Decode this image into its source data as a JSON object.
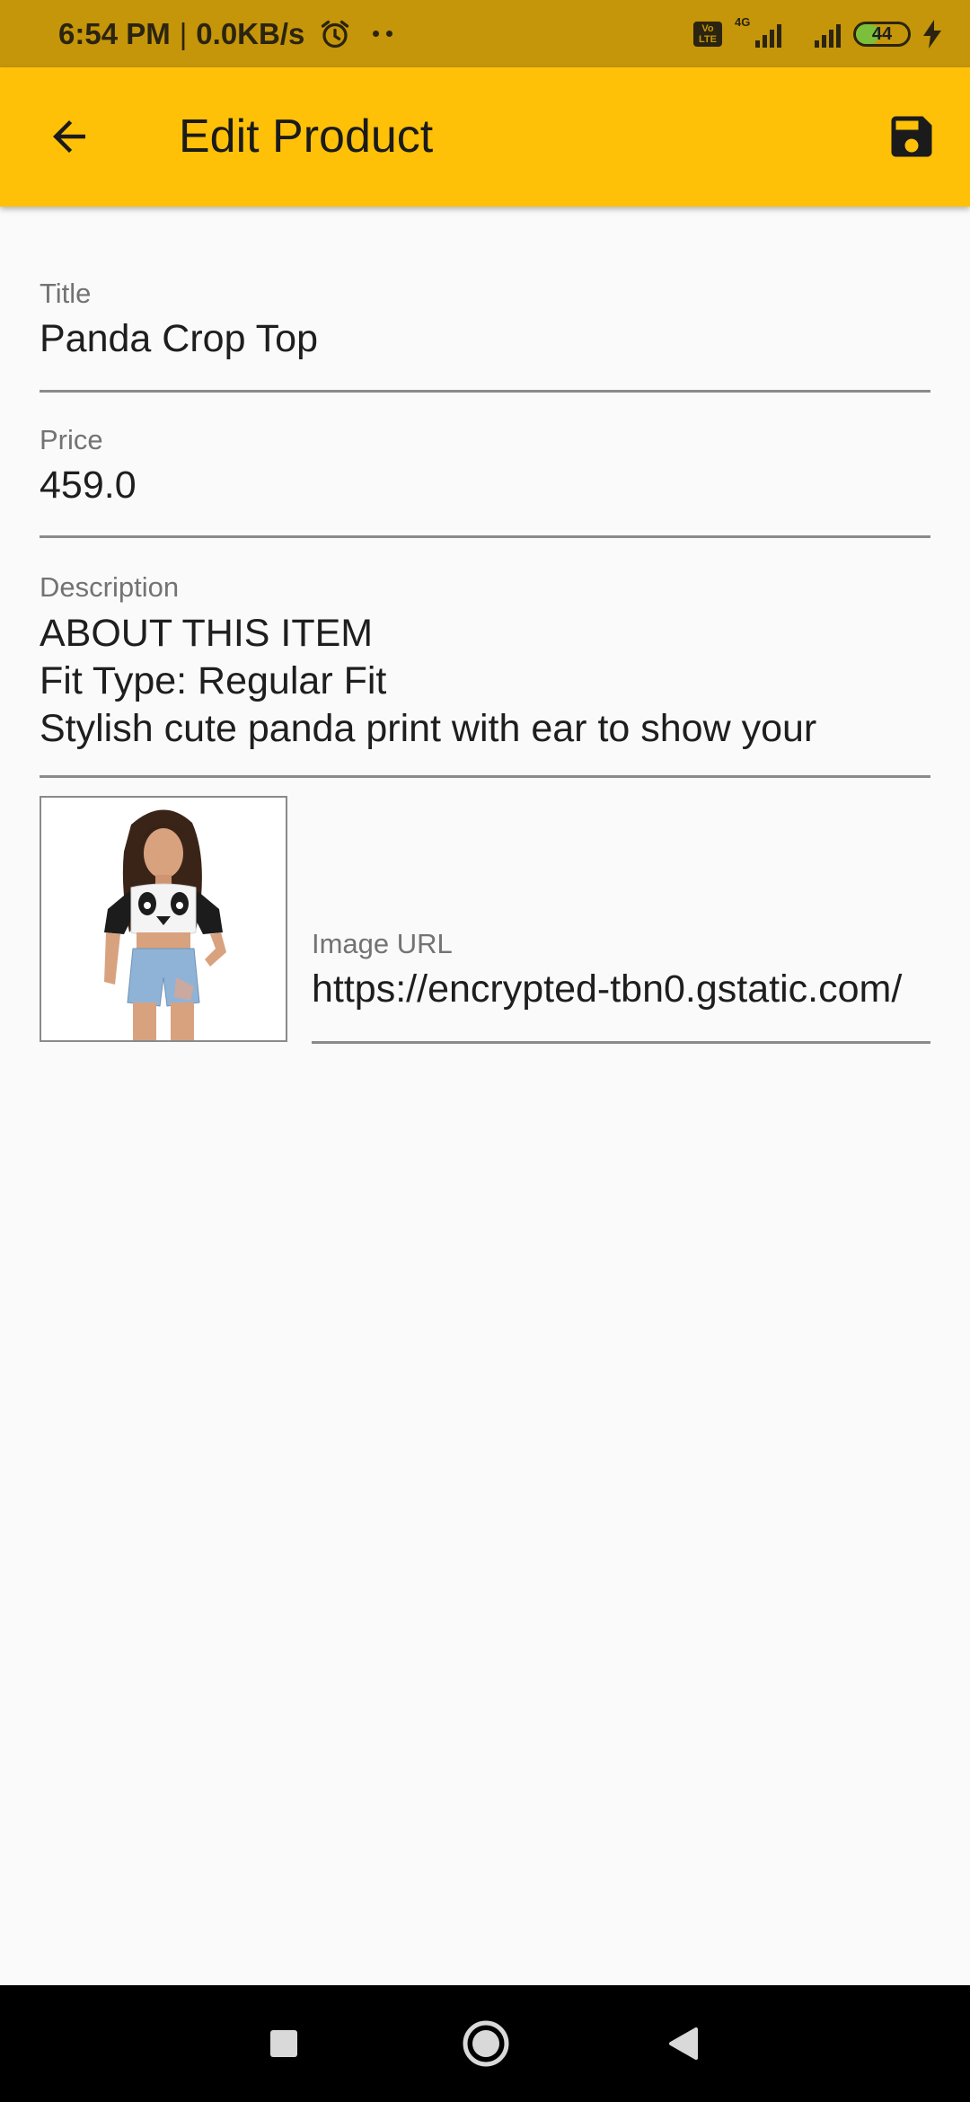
{
  "status_bar": {
    "time": "6:54 PM",
    "separator": "|",
    "net_speed": "0.0KB/s",
    "volte_line1": "Vo",
    "volte_line2": "LTE",
    "network_type": "4G",
    "battery_level": "44",
    "battery_fraction": 0.44,
    "battery_color": "#7bbf3a"
  },
  "app_bar": {
    "title": "Edit Product",
    "background_color": "#ffc107",
    "back_icon": "arrow-back-icon",
    "save_icon": "save-icon"
  },
  "form": {
    "title": {
      "label": "Title",
      "value": "Panda Crop Top"
    },
    "price": {
      "label": "Price",
      "value": "459.0"
    },
    "description": {
      "label": "Description",
      "value": "ABOUT THIS ITEM\nFit Type: Regular Fit\nStylish cute panda print with ear to show your"
    },
    "image_url": {
      "label": "Image URL",
      "value": "https://encrypted-tbn0.gstatic.com/"
    }
  },
  "nav_bar": {
    "recent_icon": "square-icon",
    "home_icon": "circle-icon",
    "back_icon": "triangle-back-icon"
  }
}
